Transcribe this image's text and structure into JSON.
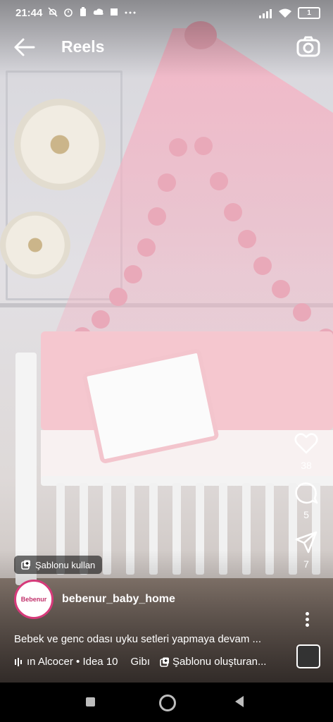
{
  "status_bar": {
    "time": "21:44",
    "left_icons": [
      "mute-icon",
      "alarm-icon",
      "battery-saver-icon",
      "cloud-icon",
      "square-icon",
      "more-dots"
    ],
    "battery": "1",
    "right_icons": [
      "signal-icon",
      "wifi-icon",
      "battery-icon"
    ]
  },
  "header": {
    "title": "Reels"
  },
  "actions": {
    "likes": "38",
    "comments": "5",
    "shares": "7"
  },
  "template_chip": {
    "label": "Şablonu kullan"
  },
  "author": {
    "username": "bebenur_baby_home",
    "avatar_text": "Bebenur"
  },
  "caption": "Bebek ve genc odası uyku setleri yapmaya devam ...",
  "audio": {
    "track": "ın Alcocer • Idea 10",
    "separator": "Gibı",
    "template_label": "Şablonu oluşturan..."
  },
  "colors": {
    "canopy": "#f2b7c6",
    "avatar_ring": "#d63a7a"
  }
}
